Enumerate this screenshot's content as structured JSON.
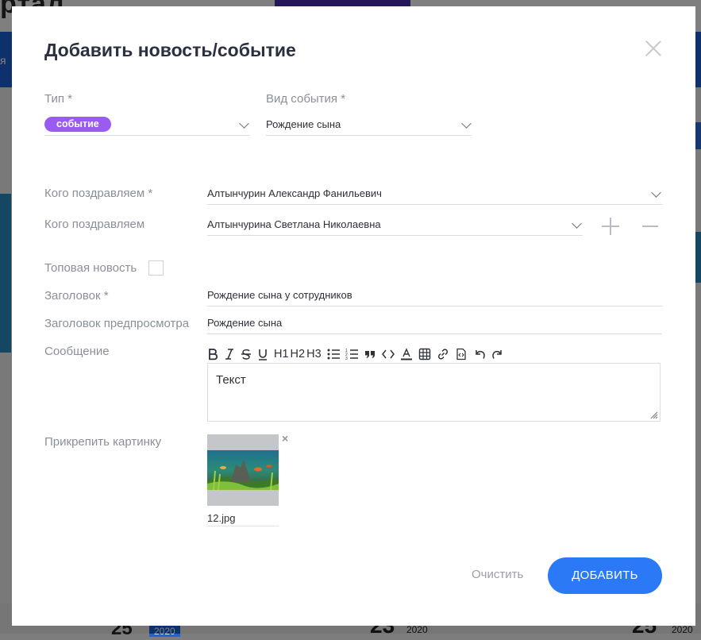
{
  "background": {
    "logo": "ртал",
    "nav_left": "я",
    "dates": [
      {
        "day": "25",
        "year": "2020"
      },
      {
        "day": "23",
        "year": "2020"
      },
      {
        "day": "25",
        "year": "2020"
      }
    ]
  },
  "modal": {
    "title": "Добавить новость/событие",
    "type": {
      "label": "Тип *",
      "value": "событие",
      "badge_color": "#9a5cf0"
    },
    "event_kind": {
      "label": "Вид события *",
      "value": "Рождение сына"
    },
    "congrats_required": {
      "label": "Кого поздравляем *",
      "value": "Алтынчурин Александр Фанильевич"
    },
    "congrats_extra": {
      "label": "Кого поздравляем",
      "value": "Алтынчурина Светлана Николаевна"
    },
    "top_news": {
      "label": "Топовая новость",
      "checked": false
    },
    "heading": {
      "label": "Заголовок *",
      "value": "Рождение сына у сотрудников"
    },
    "preview_heading": {
      "label": "Заголовок предпросмотра",
      "value": "Рождение сына"
    },
    "message": {
      "label": "Сообщение",
      "toolbar": {
        "h1": "H1",
        "h2": "H2",
        "h3": "H3"
      },
      "text": "Текст"
    },
    "attach": {
      "label": "Прикрепить картинку",
      "filename": "12.jpg",
      "remove": "×"
    },
    "buttons": {
      "clear": "Очистить",
      "submit": "ДОБАВИТЬ"
    },
    "accent_color": "#2b79f6"
  }
}
